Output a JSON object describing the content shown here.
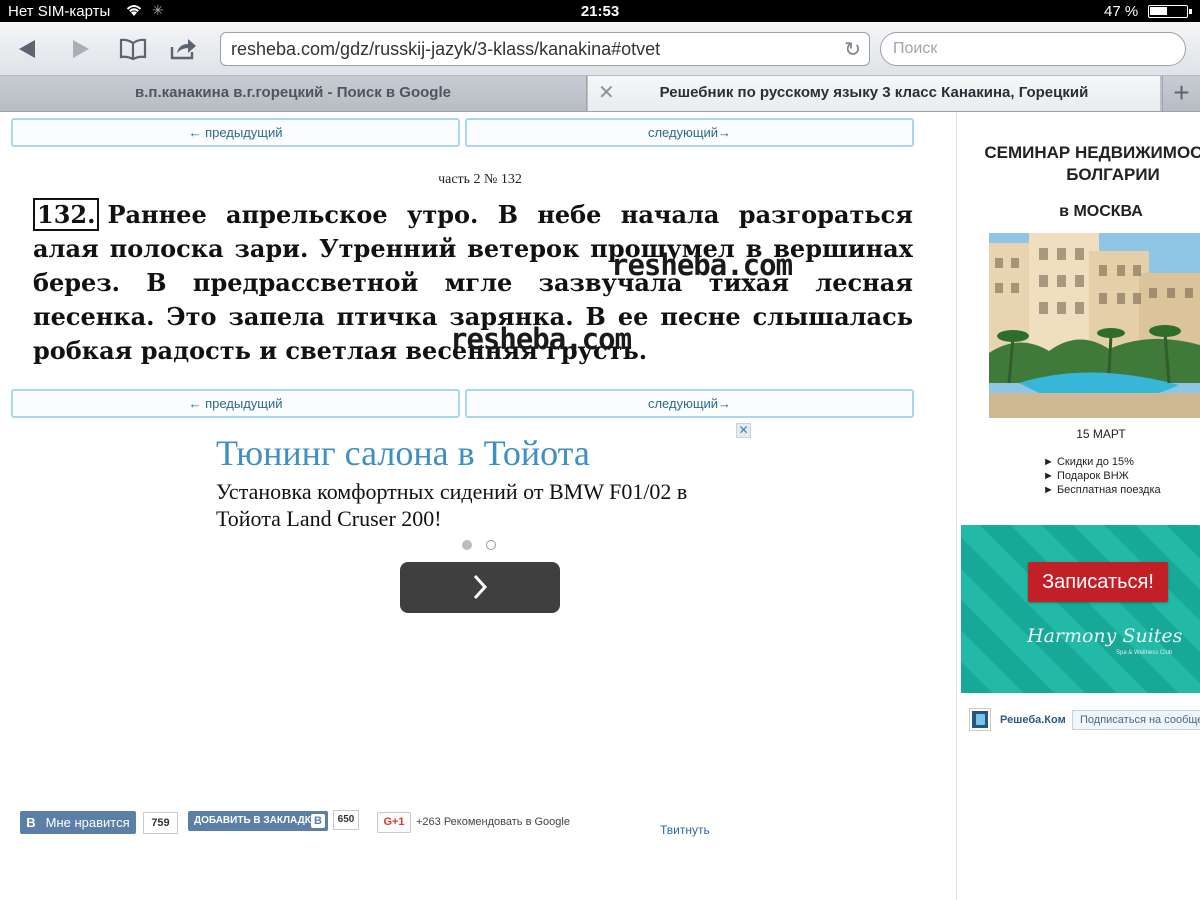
{
  "status_bar": {
    "carrier": "Нет SIM-карты",
    "time": "21:53",
    "battery": "47 %",
    "battery_level": 0.47
  },
  "browser": {
    "url": "resheba.com/gdz/russkij-jazyk/3-klass/kanakina#otvet",
    "search_placeholder": "Поиск",
    "tabs": [
      {
        "title": "в.п.канакина в.г.горецкий - Поиск в Google",
        "active": false
      },
      {
        "title": "Решебник по русскому языку 3 класс Канакина, Горецкий",
        "active": true
      }
    ],
    "new_tab_symbol": "+",
    "close_symbol": "✕",
    "icons": [
      "back-icon",
      "forward-icon",
      "bookmarks-icon",
      "share-icon",
      "reload-icon",
      "wifi-icon"
    ]
  },
  "page": {
    "prev_label": "← предыдущий",
    "next_label": "следующий→",
    "part_title": "часть 2 № 132",
    "exercise_number": "132.",
    "exercise_text": "Раннее апрельское утро. В небе начала разгораться алая полоска зари. Утренний ветерок прошумел в вершинах берез. В предрассветной мгле зазвучала тихая лесная песенка. Это запела птичка зарянка. В ее песне слышалась робкая радость и светлая весенняя грусть.",
    "watermark": "resheba.com"
  },
  "ad": {
    "close": "✕",
    "title": "Тюнинг салона в Тойота",
    "text": "Установка комфортных сидений от BMW F01/02 в Тойота Land Cruser 200!",
    "next_symbol": "›"
  },
  "social": {
    "vk_letter": "В",
    "vk_like_label": "Мне нравится",
    "vk_like_count": "759",
    "vk_bookmark_label": "ДОБАВИТЬ В ЗАКЛАДКИ",
    "vk_bookmark_count": "650",
    "gplus_label": "G+1",
    "gplus_text": "+263  Рекомендовать в Google",
    "tweet_label": "Твитнуть"
  },
  "sidebar_ad": {
    "title": "СЕМИНАР НЕДВИЖИМОСТИ В БОЛГАРИИ",
    "city": "в МОСКВА",
    "date": "15 МАРТ",
    "items": [
      "► Скидки до 15%",
      "► Подарок ВНЖ",
      "► Бесплатная поездка"
    ],
    "cta": "Записаться!",
    "brand": "Harmony Suites",
    "brand_sub": "Spa & Wellness Club",
    "colors": {
      "teal": "#1aa896",
      "cta": "#c21f27"
    }
  },
  "widget": {
    "name": "Решеба.Ком",
    "subscribe": "Подписаться на сообщество"
  }
}
